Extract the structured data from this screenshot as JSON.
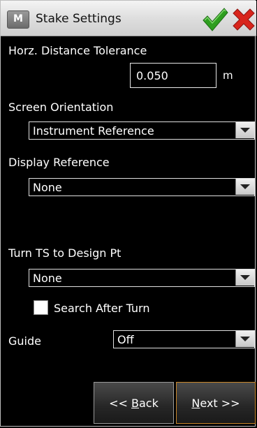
{
  "window": {
    "title": "Stake Settings",
    "app_icon_letter": "M"
  },
  "titlebar": {
    "ok_icon": "check-icon",
    "cancel_icon": "close-icon",
    "ok_color": "#2e9e1f",
    "cancel_color": "#d8251c"
  },
  "horz_tolerance": {
    "label": "Horz. Distance Tolerance",
    "value": "0.050",
    "unit": "m"
  },
  "screen_orientation": {
    "label": "Screen Orientation",
    "selected": "Instrument Reference"
  },
  "display_reference": {
    "label": "Display Reference",
    "selected": "None"
  },
  "turn_ts": {
    "label": "Turn TS to Design Pt",
    "selected": "None"
  },
  "search_after_turn": {
    "label": "Search After Turn",
    "checked": false
  },
  "guide": {
    "label": "Guide",
    "selected": "Off"
  },
  "nav": {
    "back_prefix": "<< ",
    "back_mnemonic": "B",
    "back_rest": "ack",
    "next_mnemonic": "N",
    "next_rest": "ext >>"
  }
}
